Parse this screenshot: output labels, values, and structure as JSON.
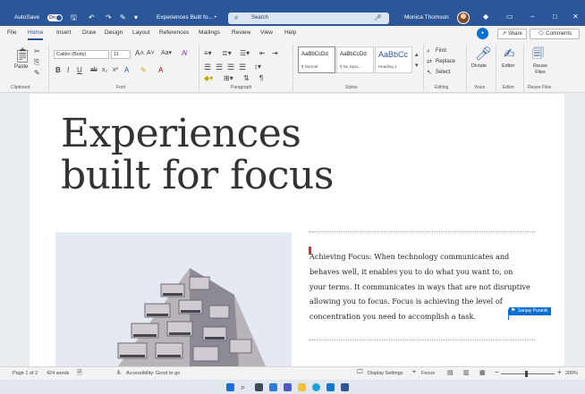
{
  "titlebar": {
    "autosave_label": "AutoSave",
    "autosave_state": "On",
    "doc_title": "Experiences Built fo... •",
    "search_placeholder": "Search",
    "user_name": "Monica Thomson"
  },
  "tabs": [
    "File",
    "Home",
    "Insert",
    "Draw",
    "Design",
    "Layout",
    "References",
    "Mailings",
    "Review",
    "View",
    "Help"
  ],
  "active_tab": "Home",
  "share_label": "Share",
  "comments_label": "Comments",
  "ribbon": {
    "clipboard": {
      "paste_label": "Paste",
      "group": "Clipboard"
    },
    "font": {
      "font_name": "Calibri (Body)",
      "font_size": "11",
      "group": "Font"
    },
    "paragraph": {
      "group": "Paragraph"
    },
    "styles": {
      "group": "Styles",
      "cards": [
        {
          "sample": "AaBbCcDd",
          "name": "¶ Normal"
        },
        {
          "sample": "AaBbCcDd",
          "name": "¶ No Spac..."
        },
        {
          "sample": "AaBbCc",
          "name": "Heading 1"
        }
      ]
    },
    "editing": {
      "find": "Find",
      "replace": "Replace",
      "select": "Select",
      "group": "Editing"
    },
    "voice": {
      "dictate": "Dictate",
      "group": "Voice"
    },
    "editor": {
      "label": "Editor",
      "group": "Editor"
    },
    "reuse": {
      "label": "Reuse Files",
      "group": "Reuse Files"
    }
  },
  "document": {
    "heading_line1": "Experiences",
    "heading_line2": "built for focus",
    "body": "Achieving Focus: When technology communicates and behaves well, it enables you to do what you want to, on your terms. It communicates in ways that are not disruptive allowing you to focus. Focus is achieving the level of concentration you need to accomplish a task.",
    "collaborator": "Sanjay Puranik"
  },
  "status": {
    "page": "Page 1 of 2",
    "words": "424 words",
    "accessibility": "Accessibility: Good to go",
    "display_settings": "Display Settings",
    "focus": "Focus",
    "zoom": "200%"
  },
  "colors": {
    "title_bar": "#2b579a",
    "accent": "#2b579a",
    "collab_blue": "#0b6fd1"
  }
}
